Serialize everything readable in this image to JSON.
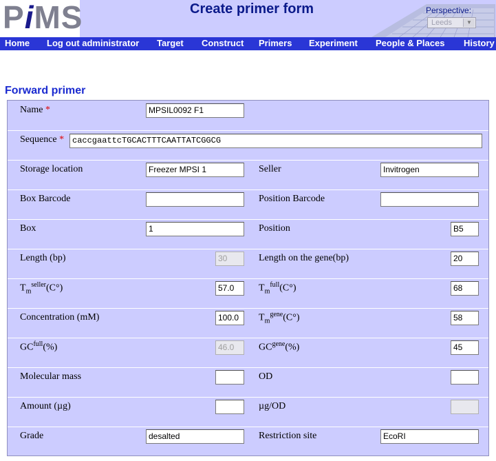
{
  "header": {
    "logo_prefix": "P",
    "logo_i": "i",
    "logo_suffix": "MS",
    "page_title": "Create primer form",
    "perspective_label": "Perspective:",
    "perspective_value": "Leeds"
  },
  "nav": {
    "home": "Home",
    "logout": "Log out administrator",
    "target": "Target",
    "construct": "Construct",
    "primers": "Primers",
    "experiment": "Experiment",
    "people": "People & Places",
    "history": "History"
  },
  "section_title": "Forward primer",
  "form": {
    "name": {
      "label": "Name",
      "required": "*",
      "value": "MPSIL0092 F1"
    },
    "sequence": {
      "label": "Sequence",
      "required": "*",
      "value": "caccgaattcTGCACTTTCAATTATCGGCG"
    },
    "storage_location": {
      "label": "Storage location",
      "value": "Freezer MPSI 1"
    },
    "seller": {
      "label": "Seller",
      "value": "Invitrogen"
    },
    "box_barcode": {
      "label": "Box Barcode",
      "value": ""
    },
    "position_barcode": {
      "label": "Position Barcode",
      "value": ""
    },
    "box": {
      "label": "Box",
      "value": "1"
    },
    "position": {
      "label": "Position",
      "value": "B5"
    },
    "length": {
      "label": "Length (bp)",
      "value": "30"
    },
    "length_gene": {
      "label": "Length on the gene(bp)",
      "value": "20"
    },
    "tm_seller": {
      "label_main": "T",
      "label_sub": "m",
      "label_sup": "seller",
      "label_unit": "(C°)",
      "value": "57.0"
    },
    "tm_full": {
      "label_main": "T",
      "label_sub": "m",
      "label_sup": "full",
      "label_unit": "(C°)",
      "value": "68"
    },
    "concentration": {
      "label": "Concentration (mM)",
      "value": "100.0"
    },
    "tm_gene": {
      "label_main": "T",
      "label_sub": "m",
      "label_sup": "gene",
      "label_unit": "(C°)",
      "value": "58"
    },
    "gc_full": {
      "label_main": "GC",
      "label_sup": "full",
      "label_unit": "(%)",
      "value": "46.0"
    },
    "gc_gene": {
      "label_main": "GC",
      "label_sup": "gene",
      "label_unit": "(%)",
      "value": "45"
    },
    "molecular_mass": {
      "label": "Molecular mass",
      "value": ""
    },
    "od": {
      "label": "OD",
      "value": ""
    },
    "amount": {
      "label": "Amount (µg)",
      "value": ""
    },
    "ug_od": {
      "label": "µg/OD",
      "value": ""
    },
    "grade": {
      "label": "Grade",
      "value": "desalted"
    },
    "restriction_site": {
      "label": "Restriction site",
      "value": "EcoRI"
    }
  },
  "colors": {
    "header_bg": "#ccccff",
    "nav_bg": "#2a36d6",
    "title": "#0b1a8a",
    "section_title": "#1a2ad0",
    "required": "#e00000"
  }
}
